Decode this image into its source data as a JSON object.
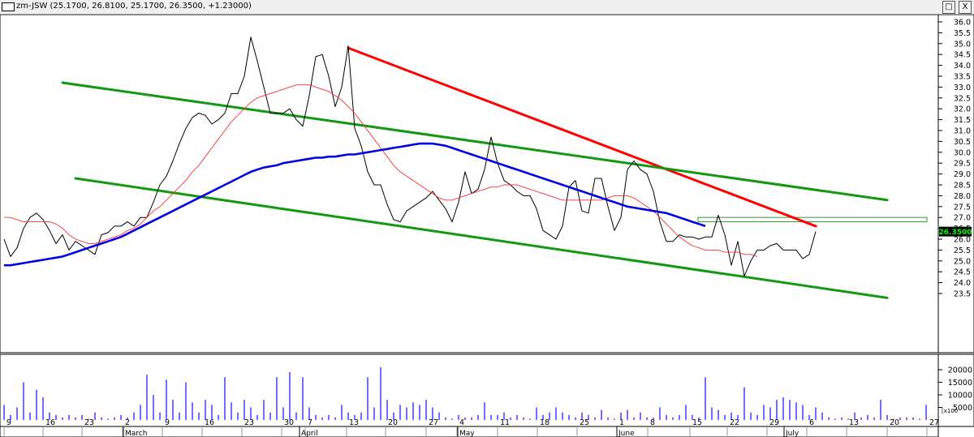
{
  "window": {
    "title": "zm-JSW (25.1700, 26.8100, 25.1700, 26.3500, +1.23000)",
    "restore_label": "□",
    "close_label": "X"
  },
  "chart_data": [
    {
      "type": "line",
      "title": "zm-JSW (25.1700, 26.8100, 25.1700, 26.3500, +1.23000)",
      "ylim": [
        23.1,
        36.3
      ],
      "y_ticks": [
        "23.5",
        "24.0",
        "24.5",
        "25.0",
        "25.5",
        "26.0",
        "26.5",
        "27.0",
        "27.5",
        "28.0",
        "28.5",
        "29.0",
        "29.5",
        "30.0",
        "30.5",
        "31.0",
        "31.5",
        "32.0",
        "32.5",
        "33.0",
        "33.5",
        "34.0",
        "34.5",
        "35.0",
        "35.5",
        "36.0"
      ],
      "last_price_label": "26.3500",
      "colors": {
        "price": "#000000",
        "ma_short": "#ff3030",
        "ma_long": "#0000e0",
        "resistance": "#ff0000",
        "channel": "#119911",
        "box": "#2e9b2e",
        "volume": "#2020ff",
        "label_bg": "#000000",
        "label_fg": "#00ff00"
      },
      "series": [
        {
          "values": [
            26,
            25.2,
            25.6,
            26.5,
            27,
            27.2,
            26.9,
            26.4,
            25.8,
            26.2,
            25.5,
            25.9,
            25.7,
            25.5,
            25.3,
            26.2,
            26.3,
            26.6,
            26.6,
            26.8,
            26.6,
            27,
            27,
            27.7,
            28.5,
            28.9,
            29.6,
            30.4,
            31.1,
            31.6,
            31.8,
            31.7,
            31.3,
            31.5,
            31.8,
            32.7,
            32.7,
            33.5,
            35.3,
            34.2,
            33,
            31.8,
            31.8,
            31.8,
            32,
            31.5,
            31.2,
            32.6,
            34.4,
            34.5,
            33.5,
            32.1,
            33,
            34.9,
            31.1,
            30.3,
            29.1,
            28.5,
            28.5,
            27.6,
            26.9,
            26.8,
            27.3,
            27.5,
            27.7,
            27.9,
            28.2,
            27.8,
            27.4,
            26.8,
            27.7,
            29.1,
            28.1,
            28.3,
            29.2,
            30.7,
            29.5,
            28.7,
            28.5,
            28.2,
            28,
            28,
            27.4,
            26.4,
            26.2,
            26,
            26.6,
            28.4,
            28.7,
            27.3,
            27.2,
            28.8,
            28.8,
            27.5,
            26.4,
            27,
            29.2,
            29.6,
            29.2,
            29,
            28.2,
            26.8,
            25.9,
            25.9,
            26.2,
            26.1,
            26.1,
            26,
            26.1,
            26.1,
            27.1,
            26.2,
            24.8,
            25.9,
            24.3,
            25,
            25.5,
            25.5,
            25.7,
            25.8,
            25.5,
            25.5,
            25.5,
            25.1,
            25.3,
            26.35
          ]
        },
        {
          "values": [
            27,
            27,
            26.9,
            26.8,
            26.8,
            26.8,
            26.8,
            26.8,
            26.7,
            26.5,
            26.2,
            26.0,
            25.9,
            25.8,
            25.8,
            25.9,
            26.0,
            26.1,
            26.2,
            26.4,
            26.5,
            26.7,
            27.0,
            27.3,
            27.5,
            27.8,
            28.1,
            28.4,
            28.7,
            29.1,
            29.4,
            29.8,
            30.2,
            30.6,
            31.0,
            31.4,
            31.7,
            32.0,
            32.3,
            32.5,
            32.6,
            32.7,
            32.8,
            32.9,
            33.0,
            33.1,
            33.1,
            33.1,
            33.0,
            32.9,
            32.8,
            32.6,
            32.4,
            32.1,
            31.8,
            31.4,
            31.0,
            30.6,
            30.2,
            29.8,
            29.4,
            29.1,
            28.9,
            28.7,
            28.5,
            28.3,
            28.1,
            27.9,
            27.8,
            27.8,
            27.9,
            28.0,
            28.1,
            28.2,
            28.3,
            28.4,
            28.4,
            28.5,
            28.5,
            28.5,
            28.4,
            28.3,
            28.2,
            28.1,
            28.0,
            27.9,
            27.8,
            27.8,
            27.8,
            27.8,
            27.8,
            27.8,
            27.8,
            27.9,
            28.0,
            28.0,
            28.0,
            27.9,
            27.7,
            27.5,
            27.3,
            27.0,
            26.7,
            26.4,
            26.1,
            25.9,
            25.7,
            25.6,
            25.5,
            25.5,
            25.5,
            25.4,
            25.4,
            25.4,
            25.3,
            25.3,
            25.2
          ]
        },
        {
          "values": [
            24.8,
            24.8,
            24.85,
            24.9,
            24.95,
            25.0,
            25.05,
            25.1,
            25.15,
            25.2,
            25.3,
            25.4,
            25.5,
            25.6,
            25.7,
            25.8,
            25.9,
            26.0,
            26.1,
            26.25,
            26.4,
            26.55,
            26.7,
            26.85,
            27.0,
            27.15,
            27.3,
            27.45,
            27.6,
            27.75,
            27.9,
            28.05,
            28.2,
            28.35,
            28.5,
            28.65,
            28.8,
            28.95,
            29.1,
            29.2,
            29.3,
            29.35,
            29.4,
            29.5,
            29.55,
            29.6,
            29.65,
            29.7,
            29.75,
            29.75,
            29.8,
            29.8,
            29.85,
            29.9,
            29.9,
            29.95,
            30.0,
            30.05,
            30.1,
            30.15,
            30.2,
            30.25,
            30.3,
            30.35,
            30.4,
            30.4,
            30.4,
            30.35,
            30.3,
            30.2,
            30.1,
            30.0,
            29.9,
            29.8,
            29.7,
            29.6,
            29.5,
            29.4,
            29.3,
            29.2,
            29.1,
            29.0,
            28.9,
            28.8,
            28.7,
            28.6,
            28.5,
            28.4,
            28.3,
            28.2,
            28.1,
            28.0,
            27.9,
            27.8,
            27.7,
            27.6,
            27.5,
            27.45,
            27.4,
            27.35,
            27.3,
            27.25,
            27.2,
            27.1,
            27.0,
            26.9,
            26.8,
            26.7,
            26.6
          ]
        }
      ],
      "trendlines": [
        {
          "points": [
            [
              53,
              34.8
            ],
            [
              125,
              26.6
            ]
          ]
        },
        {
          "points": [
            [
              9,
              33.2
            ],
            [
              136,
              27.8
            ]
          ]
        },
        {
          "points": [
            [
              11,
              28.8
            ],
            [
              136,
              23.3
            ]
          ]
        }
      ],
      "box_band": [
        26.8,
        27.0
      ]
    },
    {
      "type": "bar",
      "ylim": [
        0,
        21000
      ],
      "y_axis_unit": "x100",
      "y_ticks": [
        "5000",
        "10000",
        "15000",
        "20000"
      ],
      "x_ticks": [
        "9",
        "16",
        "23",
        "2",
        "9",
        "16",
        "23",
        "30",
        "7",
        "13",
        "20",
        "27",
        "4",
        "11",
        "18",
        "25",
        "1",
        "8",
        "15",
        "22",
        "29",
        "6",
        "13",
        "20",
        "27"
      ],
      "months": [
        "March",
        "April",
        "May",
        "June",
        "July"
      ],
      "values": [
        6000,
        2000,
        5000,
        15000,
        3000,
        12000,
        9000,
        3000,
        2000,
        1000,
        2000,
        1000,
        2000,
        500,
        3000,
        1000,
        500,
        1000,
        2000,
        1000,
        3000,
        6000,
        18000,
        10000,
        3000,
        16000,
        8000,
        3000,
        15000,
        7000,
        3000,
        8000,
        6000,
        2000,
        17000,
        7000,
        3000,
        8000,
        5000,
        2000,
        8000,
        3000,
        17000,
        5000,
        19000,
        3000,
        17000,
        5000,
        2000,
        1000,
        2000,
        1000,
        6000,
        3000,
        2000,
        3000,
        17000,
        5000,
        21000,
        8000,
        3000,
        6000,
        5000,
        7000,
        6000,
        8000,
        5000,
        3000,
        1000,
        500,
        2000,
        1000,
        1000,
        2000,
        7000,
        2000,
        2000,
        3000,
        1000,
        2000,
        1000,
        500,
        5000,
        2000,
        3000,
        5000,
        3000,
        2000,
        1000,
        3000,
        2000,
        1000,
        4000,
        1000,
        500,
        3000,
        4000,
        1000,
        3000,
        1000,
        1000,
        5000,
        2000,
        1000,
        2000,
        6000,
        2000,
        1000,
        17000,
        5000,
        4000,
        2000,
        3000,
        2000,
        13000,
        3000,
        2000,
        6000,
        5000,
        8000,
        9000,
        8000,
        7000,
        6000,
        2000,
        5000,
        3000,
        1000,
        500,
        1000,
        500,
        3000,
        1000,
        2000,
        1000,
        8000,
        2000,
        500,
        1000,
        1000,
        1000,
        500,
        6000
      ]
    }
  ]
}
